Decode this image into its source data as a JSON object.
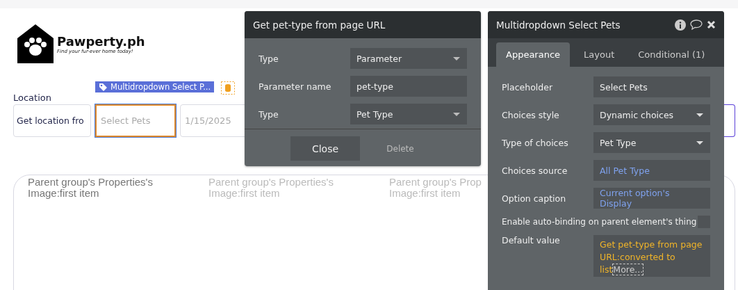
{
  "logo": {
    "name": "Pawperty.ph",
    "tagline": "Find your fur-ever home today!"
  },
  "filters": [
    {
      "kind": "text",
      "label": "Location",
      "value": "Get location fro",
      "selected": false
    },
    {
      "kind": "multidropdown",
      "placeholder": "Select Pets",
      "selected": true
    },
    {
      "kind": "date",
      "placeholder": "1/15/2025",
      "selected": false
    }
  ],
  "element_tag": {
    "label": "Multidropdown Select P..."
  },
  "repeating_group": {
    "cells": [
      {
        "text": "Parent group's Properties's Image:first item",
        "selected": true
      },
      {
        "text": "Parent group's Properties's Image:first item",
        "selected": false
      },
      {
        "text": "Parent group's Prop Image:first item",
        "selected": false
      }
    ]
  },
  "expression_popup": {
    "title": "Get pet-type from page URL",
    "rows": [
      {
        "label": "Type",
        "value": "Parameter",
        "kind": "dropdown"
      },
      {
        "label": "Parameter name",
        "value": "pet-type",
        "kind": "input"
      },
      {
        "label": "Type",
        "value": "Pet Type",
        "kind": "dropdown"
      }
    ],
    "close": "Close",
    "delete": "Delete"
  },
  "property_editor": {
    "title": "Multidropdown Select Pets",
    "tabs": [
      {
        "label": "Appearance",
        "selected": true
      },
      {
        "label": "Layout",
        "selected": false
      },
      {
        "label": "Conditional (1)",
        "selected": false
      }
    ],
    "rows": [
      {
        "label": "Placeholder",
        "value": "Select Pets",
        "kind": "input"
      },
      {
        "label": "Choices style",
        "value": "Dynamic choices",
        "kind": "dropdown"
      },
      {
        "label": "Type of choices",
        "value": "Pet Type",
        "kind": "dropdown"
      },
      {
        "label": "Choices source",
        "value": "All Pet Type",
        "kind": "expression"
      },
      {
        "label": "Option caption",
        "value": "Current option's Display",
        "kind": "expression"
      },
      {
        "label": "Enable auto-binding on parent element's thing",
        "checked": false,
        "kind": "checkbox"
      },
      {
        "label": "Default value",
        "value": "Get pet-type from page URL:converted to list",
        "more": "More...",
        "kind": "dynamic"
      }
    ]
  }
}
